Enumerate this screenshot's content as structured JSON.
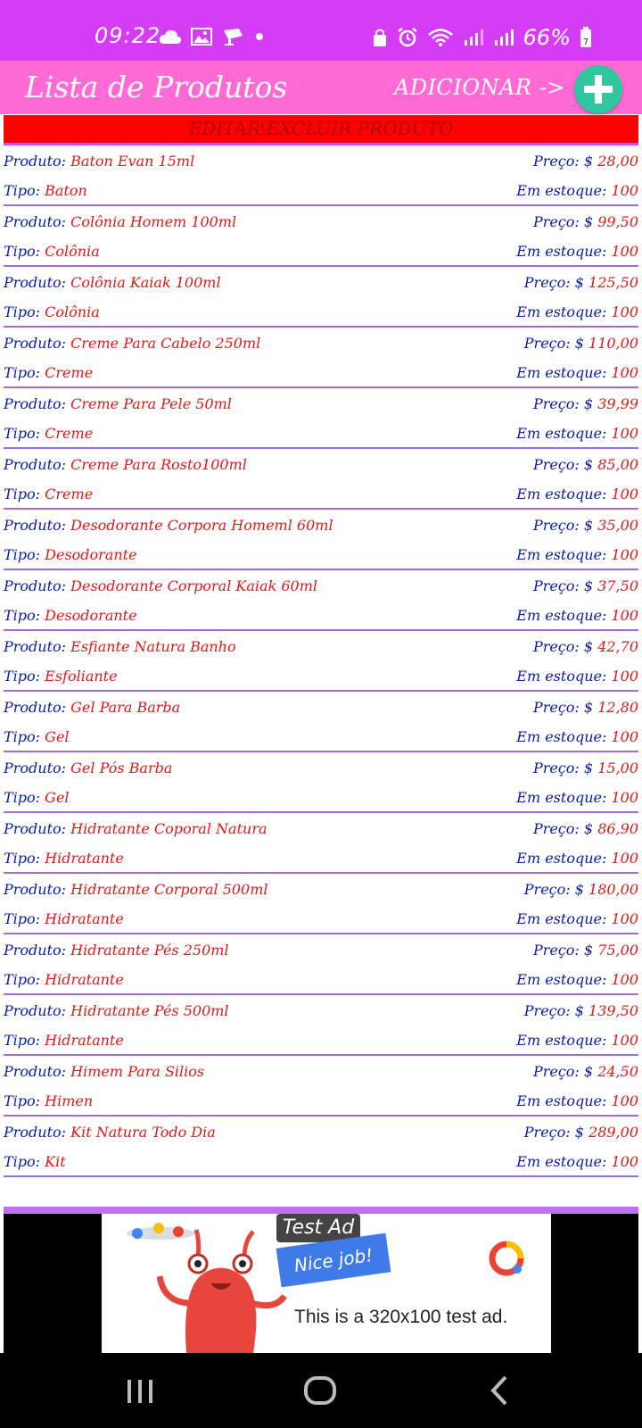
{
  "status_bar": {
    "time": "09:22",
    "battery": "66%",
    "left_icons": [
      "cloud-icon",
      "image-icon",
      "cast-icon",
      "dot-icon"
    ],
    "right_icons": [
      "lock-icon",
      "alarm-icon",
      "wifi-icon",
      "signal-icon",
      "signal-icon",
      "battery-icon"
    ]
  },
  "app_bar": {
    "title": "Lista de Produtos",
    "add_label": "ADICIONAR ->",
    "fab_icon": "plus-icon"
  },
  "edit_banner": "EDITAR\\EXCLUIR PRODUTO",
  "labels": {
    "produto": "Produto:",
    "tipo": "Tipo:",
    "preco": "Preço: $",
    "estoque": "Em estoque:"
  },
  "products": [
    {
      "name": "Baton Evan 15ml",
      "type": "Baton",
      "price": "28,00",
      "stock": "100"
    },
    {
      "name": "Colônia Homem 100ml",
      "type": "Colônia",
      "price": "99,50",
      "stock": "100"
    },
    {
      "name": "Colônia Kaiak 100ml",
      "type": "Colônia",
      "price": "125,50",
      "stock": "100"
    },
    {
      "name": "Creme Para Cabelo 250ml",
      "type": "Creme",
      "price": "110,00",
      "stock": "100"
    },
    {
      "name": "Creme Para Pele 50ml",
      "type": "Creme",
      "price": "39,99",
      "stock": "100"
    },
    {
      "name": "Creme Para Rosto100ml",
      "type": "Creme",
      "price": "85,00",
      "stock": "100"
    },
    {
      "name": "Desodorante Corpora Homeml 60ml",
      "type": "Desodorante",
      "price": "35,00",
      "stock": "100"
    },
    {
      "name": "Desodorante Corporal Kaiak 60ml",
      "type": "Desodorante",
      "price": "37,50",
      "stock": "100"
    },
    {
      "name": "Esfiante Natura Banho",
      "type": "Esfoliante",
      "price": "42,70",
      "stock": "100"
    },
    {
      "name": "Gel Para Barba",
      "type": "Gel",
      "price": "12,80",
      "stock": "100"
    },
    {
      "name": "Gel Pós Barba",
      "type": "Gel",
      "price": "15,00",
      "stock": "100"
    },
    {
      "name": "Hidratante Coporal Natura",
      "type": "Hidratante",
      "price": "86,90",
      "stock": "100"
    },
    {
      "name": "Hidratante Corporal 500ml",
      "type": "Hidratante",
      "price": "180,00",
      "stock": "100"
    },
    {
      "name": "Hidratante Pés 250ml",
      "type": "Hidratante",
      "price": "75,00",
      "stock": "100"
    },
    {
      "name": "Hidratante Pés 500ml",
      "type": "Hidratante",
      "price": "139,50",
      "stock": "100"
    },
    {
      "name": "Himem Para Silios",
      "type": "Himen",
      "price": "24,50",
      "stock": "100"
    },
    {
      "name": "Kit Natura Todo Dia",
      "type": "Kit",
      "price": "289,00",
      "stock": "100"
    }
  ],
  "ad": {
    "badge": "Test Ad",
    "banner": "Nice job!",
    "text": "This is a 320x100 test ad."
  },
  "nav_bar": {
    "icons": [
      "recent-apps-icon",
      "home-icon",
      "back-icon"
    ]
  }
}
